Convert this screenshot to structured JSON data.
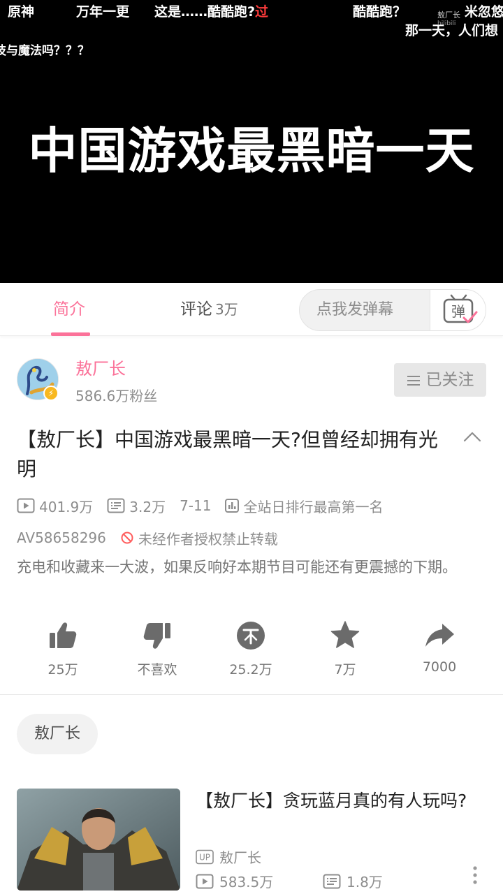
{
  "player": {
    "video_title": "中国游戏最黑暗一天",
    "watermark_name": "敖厂长",
    "watermark_site": "bilibili",
    "danmaku": [
      {
        "text": "原神",
        "highlight": ""
      },
      {
        "text": "万年一更",
        "highlight": ""
      },
      {
        "text": "这是……酷酷跑?",
        "highlight": "过"
      },
      {
        "text": "酷酷跑？",
        "highlight": ""
      },
      {
        "text": "米忽悠",
        "highlight": ""
      },
      {
        "text": "那一天，人们想",
        "highlight": ""
      },
      {
        "text": "技与魔法吗？？？",
        "highlight": ""
      }
    ]
  },
  "tabs": {
    "intro_label": "简介",
    "comments_label": "评论",
    "comments_count": "3万",
    "danmaku_placeholder": "点我发弹幕",
    "danmaku_icon_char": "弹"
  },
  "uploader": {
    "name": "敖厂长",
    "fans": "586.6万粉丝",
    "follow_label": "已关注"
  },
  "video": {
    "title": "【敖厂长】中国游戏最黑暗一天?但曾经却拥有光明",
    "views": "401.9万",
    "danmaku_count": "3.2万",
    "date": "7-11",
    "rank": "全站日排行最高第一名",
    "av_id": "AV58658296",
    "copyright_notice": "未经作者授权禁止转载",
    "description": "充电和收藏来一大波，如果反响好本期节目可能还有更震撼的下期。"
  },
  "actions": {
    "like": "25万",
    "dislike": "不喜欢",
    "coin": "25.2万",
    "favorite": "7万",
    "share": "7000"
  },
  "tags": [
    "敖厂长"
  ],
  "recommendation": {
    "title": "【敖厂长】贪玩蓝月真的有人玩吗?",
    "uploader_badge": "UP",
    "uploader": "敖厂长",
    "views": "583.5万",
    "danmaku": "1.8万"
  },
  "colors": {
    "accent": "#fb7299",
    "badge": "#f8b81f",
    "danmaku_highlight": "#ff3b3b",
    "icon_gray": "#6b6b6b"
  }
}
